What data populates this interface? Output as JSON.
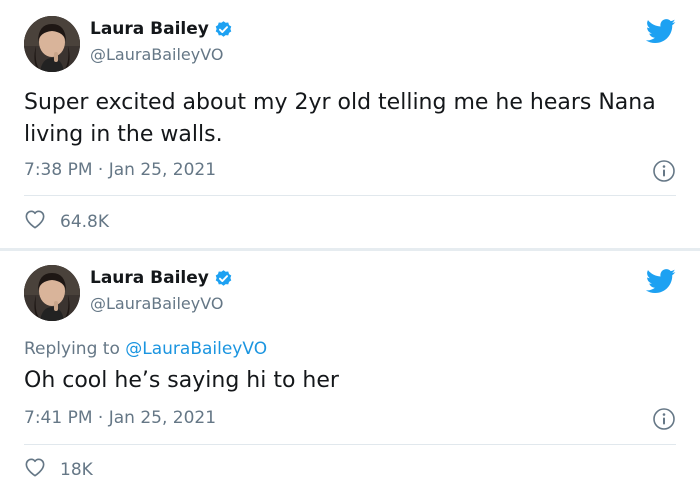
{
  "tweets": [
    {
      "name": "Laura Bailey",
      "handle": "@LauraBaileyVO",
      "text": "Super excited about my 2yr old telling me he hears Nana living in the walls.",
      "time": "7:38 PM · Jan 25, 2021",
      "likes": "64.8K"
    },
    {
      "name": "Laura Bailey",
      "handle": "@LauraBaileyVO",
      "replying_label": "Replying to",
      "replying_to": "@LauraBaileyVO",
      "text": "Oh cool he’s saying hi to her",
      "time": "7:41 PM · Jan 25, 2021",
      "likes": "18K"
    }
  ],
  "colors": {
    "twitter_blue": "#1da1f2",
    "link_blue": "#1b95e0",
    "secondary_text": "#657786",
    "background": "#e6ecf0"
  },
  "icons": [
    "verified-badge-icon",
    "twitter-bird-icon",
    "info-icon",
    "heart-icon"
  ]
}
